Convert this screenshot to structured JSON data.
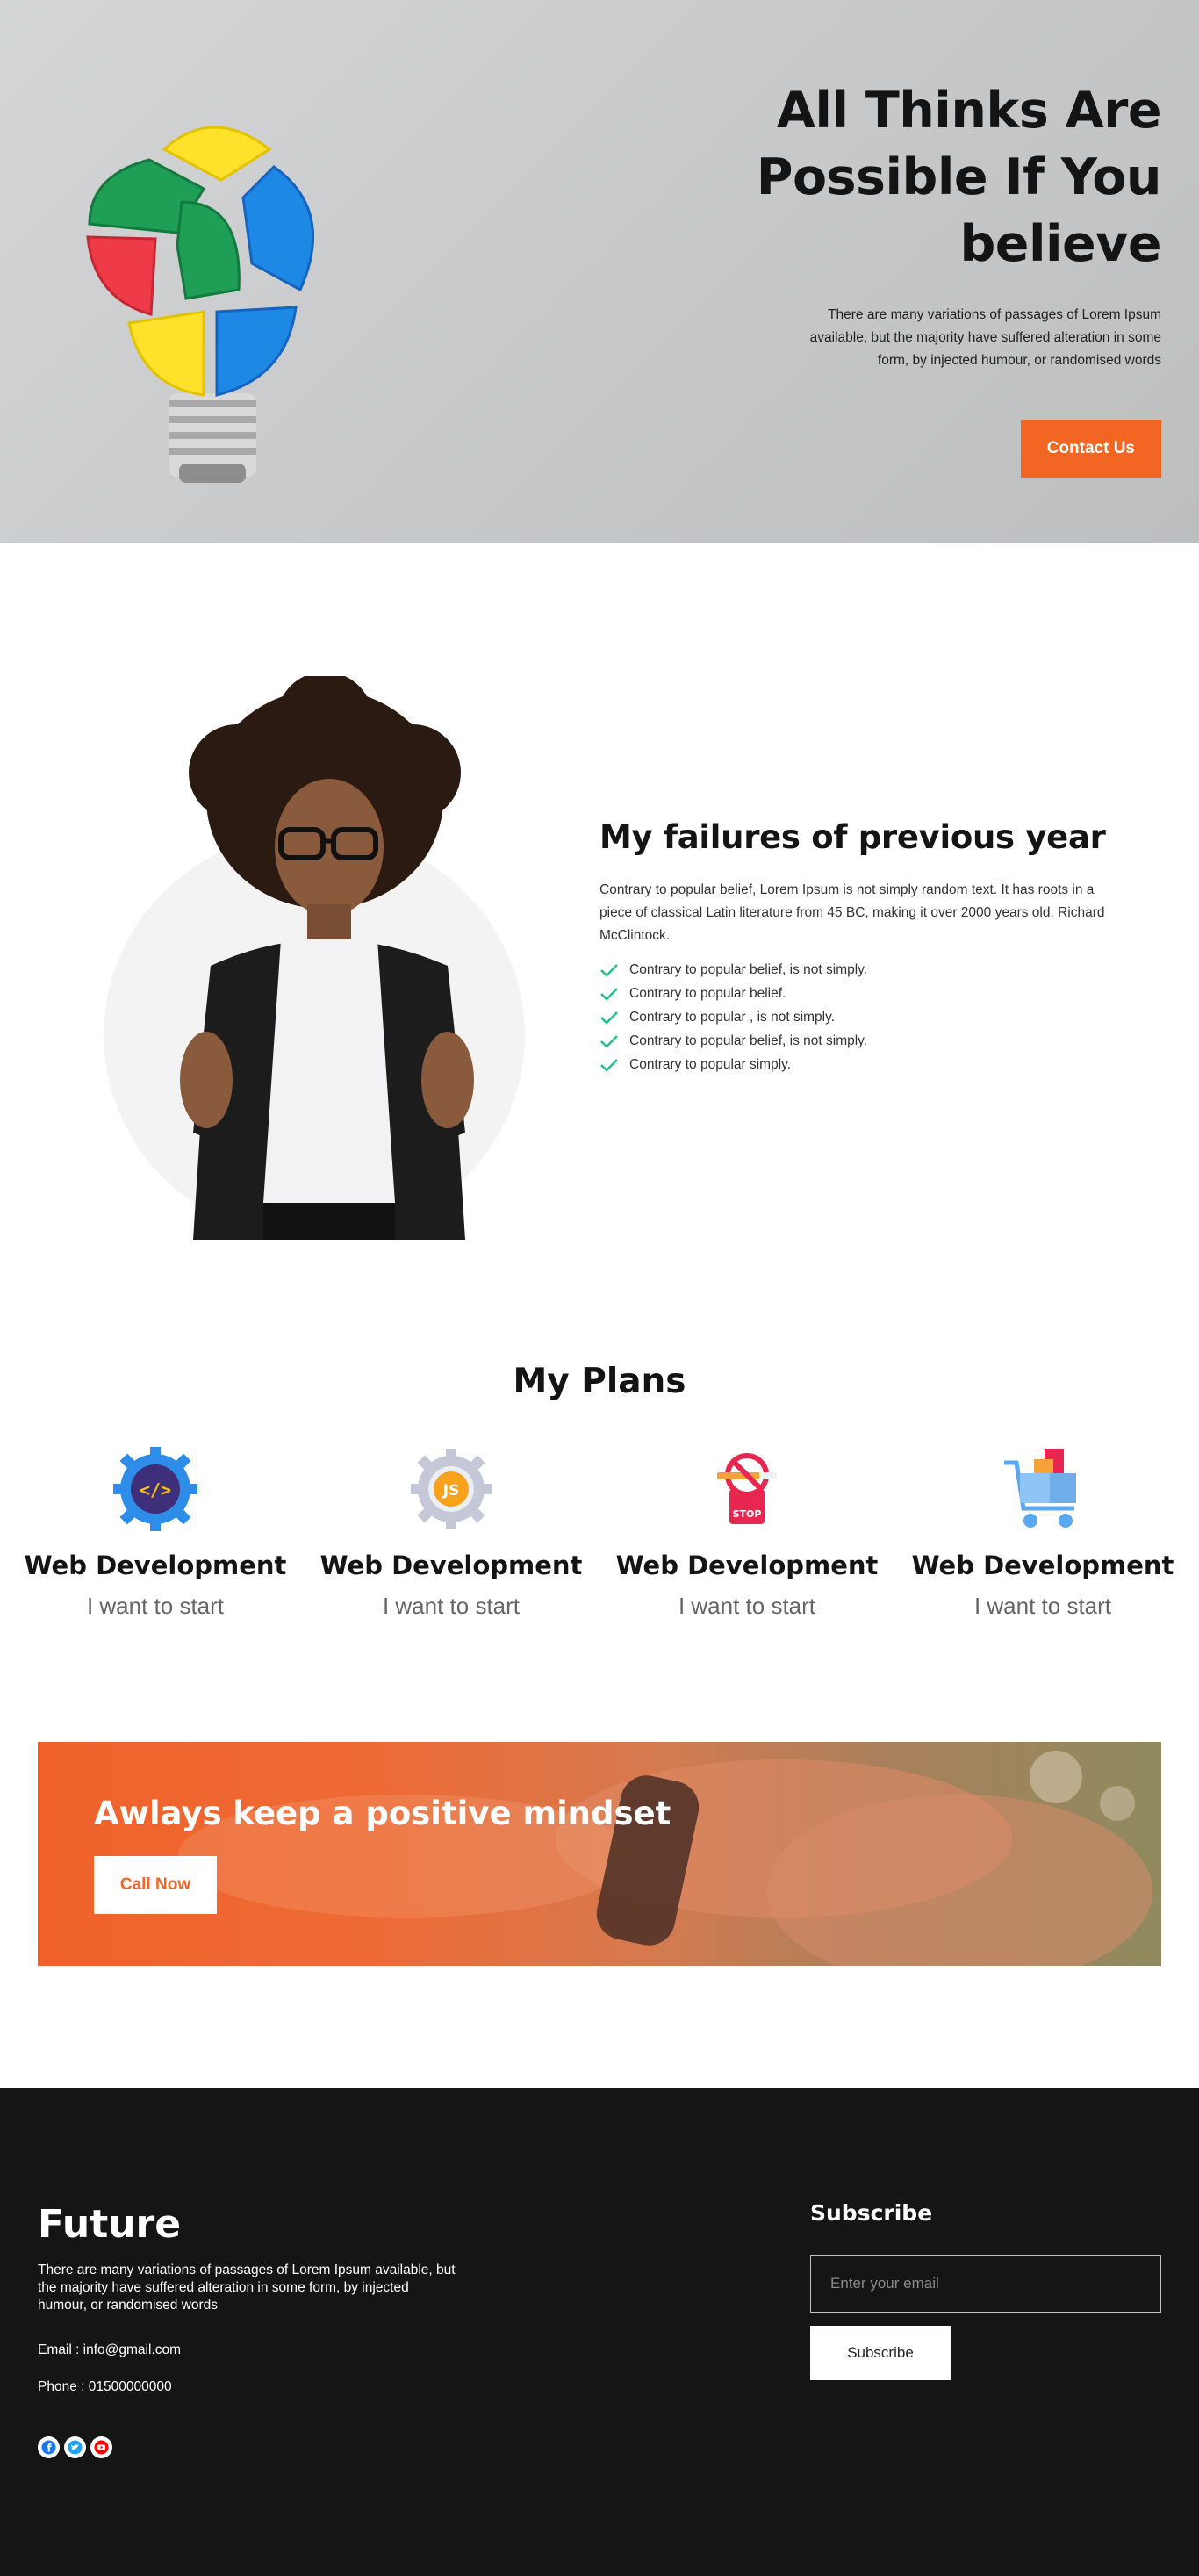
{
  "hero": {
    "title_line1": "All Thinks Are",
    "title_line2": "Possible If You",
    "title_line3": "believe",
    "text": "There are many variations of passages of Lorem Ipsum available, but the majority have suffered alteration in some form, by injected humour, or randomised words",
    "button_label": "Contact Us"
  },
  "failures": {
    "title": "My failures of previous year",
    "text": "Contrary to popular belief, Lorem Ipsum is not simply random text. It has roots in a piece of classical Latin literature from 45 BC, making it over 2000 years old. Richard McClintock.",
    "items": [
      "Contrary to popular belief, is not simply.",
      "Contrary to popular belief.",
      "Contrary to popular , is not simply.",
      "Contrary to popular belief, is not simply.",
      "Contrary to popular simply."
    ]
  },
  "plans": {
    "title": "My Plans",
    "items": [
      {
        "icon": "code-gear-icon",
        "title": "Web Development",
        "subtitle": "I want to start"
      },
      {
        "icon": "js-gear-icon",
        "title": "Web Development",
        "subtitle": "I want to start"
      },
      {
        "icon": "stop-smoking-icon",
        "title": "Web Development",
        "subtitle": "I want to start"
      },
      {
        "icon": "shopping-cart-icon",
        "title": "Web Development",
        "subtitle": "I want to start"
      }
    ]
  },
  "banner": {
    "title": "Awlays keep a positive mindset",
    "button_label": "Call Now"
  },
  "footer": {
    "brand": "Future",
    "text": "There are many variations of passages of Lorem Ipsum available, but the majority have suffered alteration in some form, by injected humour, or randomised words",
    "email": "Email : info@gmail.com",
    "phone": "Phone : 01500000000",
    "socials": [
      "facebook-icon",
      "twitter-icon",
      "youtube-icon"
    ],
    "subscribe_title": "Subscribe",
    "subscribe_placeholder": "Enter your email",
    "subscribe_button": "Subscribe"
  },
  "colors": {
    "accent": "#f26522",
    "check": "#1ec28b",
    "footer_bg": "#151515"
  }
}
